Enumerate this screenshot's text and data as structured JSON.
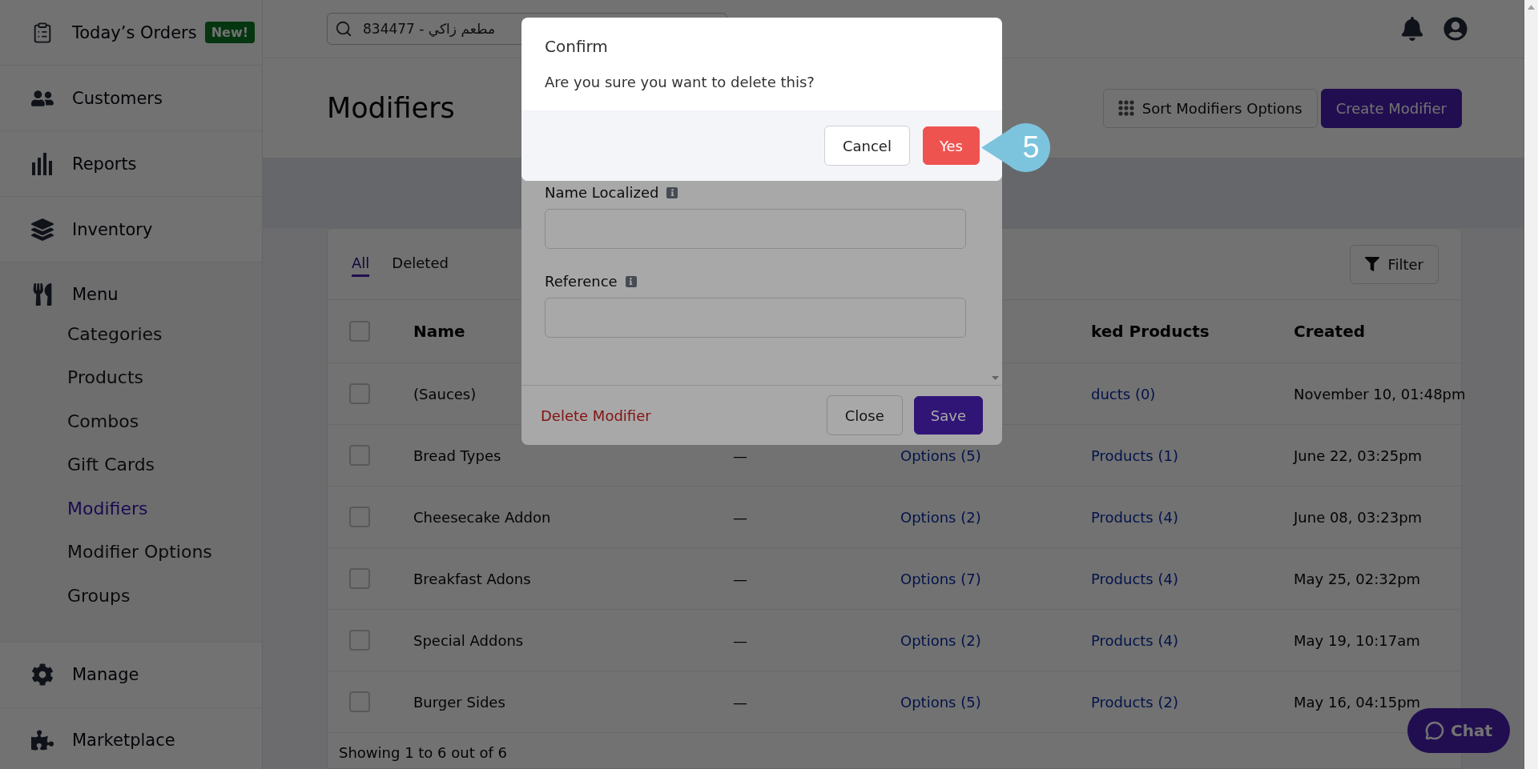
{
  "search": {
    "placeholder": "834477 - مطعم زاكي"
  },
  "sidebar": {
    "sections": [
      {
        "label": "Today’s Orders",
        "badge": "New!"
      },
      {
        "label": "Customers"
      },
      {
        "label": "Reports"
      },
      {
        "label": "Inventory"
      },
      {
        "label": "Menu",
        "children": [
          {
            "label": "Categories",
            "selected": false
          },
          {
            "label": "Products",
            "selected": false
          },
          {
            "label": "Combos",
            "selected": false
          },
          {
            "label": "Gift Cards",
            "selected": false
          },
          {
            "label": "Modifiers",
            "selected": true
          },
          {
            "label": "Modifier Options",
            "selected": false
          },
          {
            "label": "Groups",
            "selected": false
          }
        ]
      },
      {
        "label": "Manage"
      },
      {
        "label": "Marketplace"
      }
    ]
  },
  "page_header": {
    "title": "Modifiers",
    "buttons": [
      {
        "kind": "secondary",
        "label": "Sort Modifiers Options"
      },
      {
        "kind": "primary",
        "label": "Create Modifier"
      }
    ]
  },
  "table": {
    "tabs": [
      {
        "label": "All",
        "selected": true
      },
      {
        "label": "Deleted",
        "selected": false
      }
    ],
    "filter_button": "Filter",
    "header": {
      "checked": false,
      "name": "Name",
      "column_4": "ked Products",
      "created": "Created"
    },
    "rows": [
      {
        "checked": false,
        "name": "(Sauces)",
        "column_4": "ducts (0)",
        "created": "November 10, 01:48pm"
      },
      {
        "checked": false,
        "name": "Bread Types",
        "column_2": "—",
        "column_3": "Options (5)",
        "column_4": "Products (1)",
        "created": "June 22, 03:25pm"
      },
      {
        "checked": false,
        "name": "Cheesecake Addon",
        "column_2": "—",
        "column_3": "Options (2)",
        "column_4": "Products (4)",
        "created": "June 08, 03:23pm"
      },
      {
        "checked": false,
        "name": "Breakfast Adons",
        "column_2": "—",
        "column_3": "Options (7)",
        "column_4": "Products (4)",
        "created": "May 25, 02:32pm"
      },
      {
        "checked": false,
        "name": "Special Addons",
        "column_2": "—",
        "column_3": "Options (2)",
        "column_4": "Products (4)",
        "created": "May 19, 10:17am"
      },
      {
        "checked": false,
        "name": "Burger Sides",
        "column_2": "—",
        "column_3": "Options (5)",
        "column_4": "Products (2)",
        "created": "May 16, 04:15pm"
      }
    ],
    "footer": "Showing 1 to 6 out of 6"
  },
  "chat_button": "Chat",
  "modifier_modal": {
    "fields": [
      {
        "label": "Name Localized"
      },
      {
        "label": "Reference"
      }
    ],
    "delete_link": "Delete Modifier",
    "buttons": [
      {
        "kind": "secondary",
        "label": "Close"
      },
      {
        "kind": "primary",
        "label": "Save"
      }
    ]
  },
  "confirm_dialog": {
    "title": "Confirm",
    "message": "Are you sure you want to delete this?",
    "buttons": [
      {
        "kind": "secondary",
        "label": "Cancel"
      },
      {
        "kind": "danger",
        "label": "Yes"
      }
    ]
  },
  "step_badge": "5"
}
